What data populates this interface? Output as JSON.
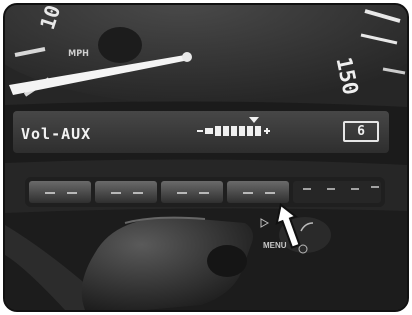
{
  "gauge": {
    "unit": "MPH",
    "mark_low": "10",
    "mark_high": "150"
  },
  "display": {
    "mode_text": "Vol-AUX",
    "preset": "6",
    "volume_plus": "+",
    "volume_minus": "-"
  },
  "controls": {
    "menu_label": "MENU"
  },
  "colors": {
    "dashboard": "#2a2a2a",
    "lcd": "#3a3a3a",
    "lcd_text": "#f2f2f2",
    "needle": "#f4f4f4"
  }
}
